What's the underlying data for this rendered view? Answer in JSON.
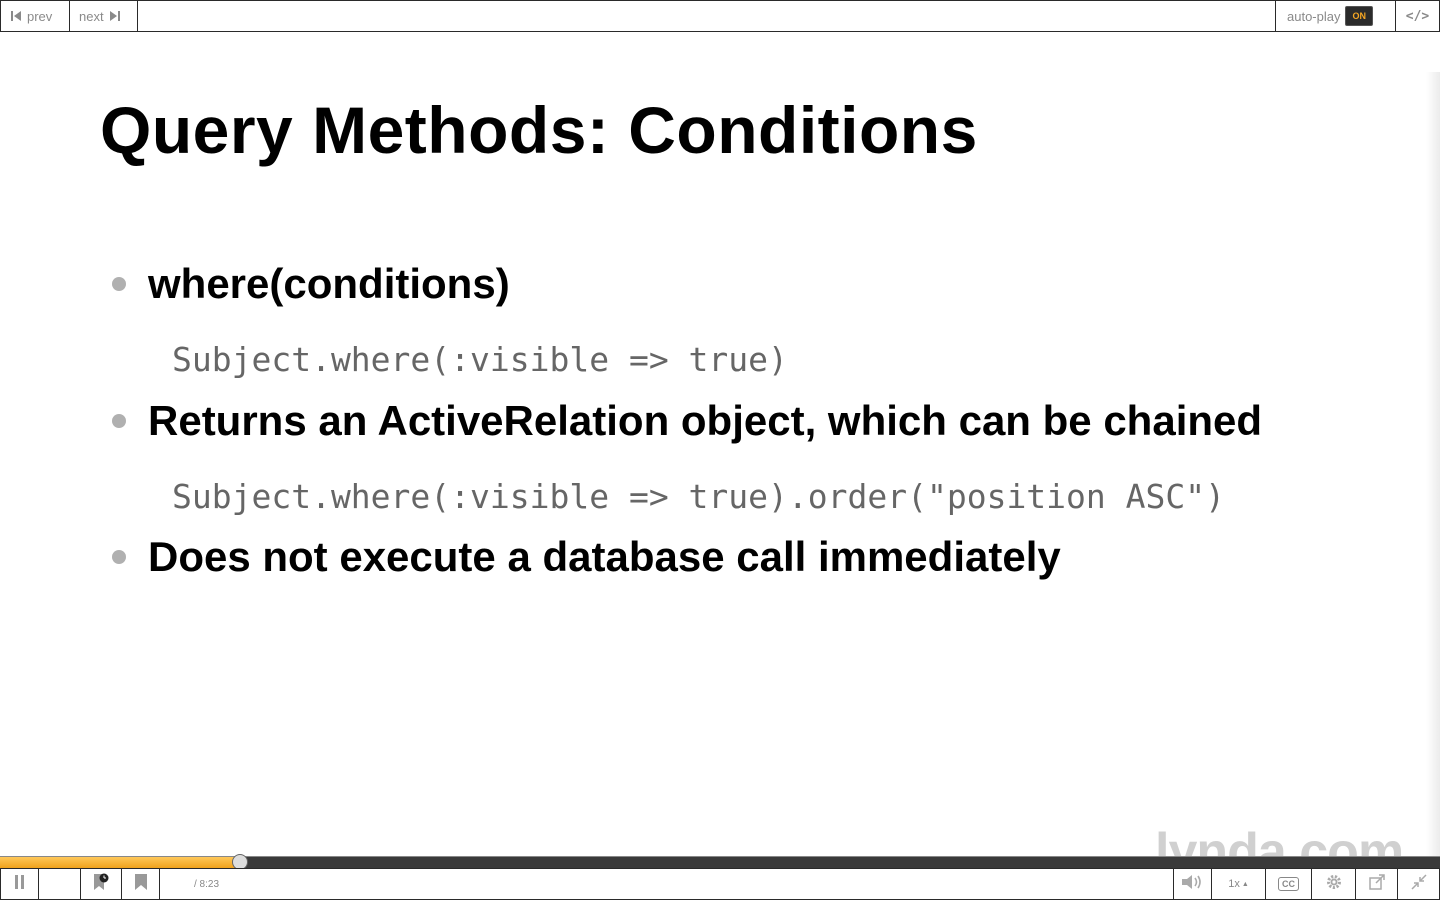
{
  "topbar": {
    "prev_label": "prev",
    "next_label": "next",
    "autoplay_label": "auto-play",
    "autoplay_state": "ON",
    "code_label": "</>"
  },
  "slide": {
    "title": "Query Methods: Conditions",
    "bullets": [
      {
        "text": "where(conditions)",
        "code": "Subject.where(:visible => true)"
      },
      {
        "text": "Returns an ActiveRelation object, which can be chained",
        "code": "Subject.where(:visible => true).order(\"position ASC\")"
      },
      {
        "text": "Does not execute a database call immediately"
      }
    ],
    "watermark": "lynda.com"
  },
  "player": {
    "progress": 0.167,
    "duration_text": "/ 8:23",
    "speed_label": "1x",
    "cc_label": "CC",
    "colors": {
      "accent": "#f5a623",
      "bar": "#3a3a3a"
    }
  },
  "icons": [
    "skip-back-icon",
    "skip-forward-icon",
    "pause-icon",
    "bookmark-clock-icon",
    "bookmark-icon",
    "volume-icon",
    "cc-icon",
    "gear-icon",
    "popout-icon",
    "collapse-icon"
  ]
}
